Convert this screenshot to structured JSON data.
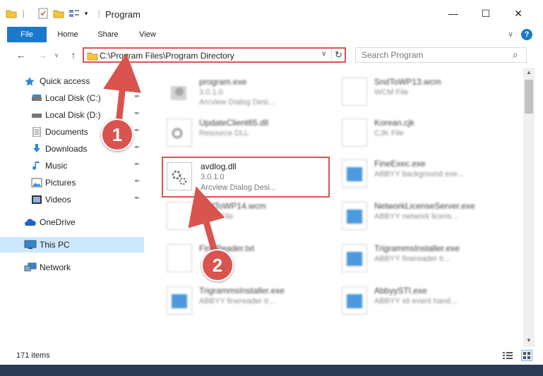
{
  "window": {
    "title": "Program",
    "min_glyph": "—",
    "max_glyph": "☐",
    "close_glyph": "✕"
  },
  "ribbon": {
    "tabs": [
      "File",
      "Home",
      "Share",
      "View"
    ],
    "collapse_glyph": "∨",
    "help_glyph": "?"
  },
  "nav": {
    "back_glyph": "←",
    "forward_glyph": "→",
    "recent_glyph": "∨",
    "up_glyph": "↑",
    "address": "C:\\Program Files\\Program Directory",
    "address_dropdown_glyph": "∨",
    "refresh_glyph": "↻",
    "search_placeholder": "Search Program",
    "search_glyph": "⌕"
  },
  "sidebar": {
    "items": [
      {
        "label": "Quick access",
        "icon": "star-icon"
      },
      {
        "label": "Local Disk (C:)",
        "icon": "drive-icon",
        "pinned": true
      },
      {
        "label": "Local Disk (D:)",
        "icon": "drive-icon",
        "pinned": true
      },
      {
        "label": "Documents",
        "icon": "documents-icon",
        "pinned": true
      },
      {
        "label": "Downloads",
        "icon": "download-icon",
        "pinned": true
      },
      {
        "label": "Music",
        "icon": "music-icon",
        "pinned": true
      },
      {
        "label": "Pictures",
        "icon": "pictures-icon",
        "pinned": true
      },
      {
        "label": "Videos",
        "icon": "videos-icon",
        "pinned": true
      },
      {
        "label": "OneDrive",
        "icon": "cloud-icon"
      },
      {
        "label": "This PC",
        "icon": "computer-icon",
        "selected": true
      },
      {
        "label": "Network",
        "icon": "network-icon"
      }
    ],
    "pin_glyph": "✒"
  },
  "files": [
    {
      "name": "program.exe",
      "line2": "3.0.1.0",
      "line3": "Arcview Dialog Desi...",
      "icon": "exe-icon"
    },
    {
      "name": "SndToWP13.wcm",
      "line2": "WCM File",
      "line3": "",
      "icon": "document-icon"
    },
    {
      "name": "UpdateClient65.dll",
      "line2": "Resource DLL",
      "line3": "",
      "icon": "gear-dll-icon"
    },
    {
      "name": "Korean.cjk",
      "line2": "CJK File",
      "line3": "",
      "icon": "document-icon"
    },
    {
      "name": "avdlog.dll",
      "line2": "3.0.1.0",
      "line3": "Arcview Dialog Desi...",
      "icon": "gear-dll-icon",
      "highlight": true
    },
    {
      "name": "FineExec.exe",
      "line2": "ABBYY background exe...",
      "line3": "",
      "icon": "app-icon"
    },
    {
      "name": "SndToWP14.wcm",
      "line2": "WCM File",
      "line3": "",
      "icon": "document-icon"
    },
    {
      "name": "NetworkLicenseServer.exe",
      "line2": "ABBYY network licens...",
      "line3": "",
      "icon": "app-icon"
    },
    {
      "name": "FineReader.txt",
      "line2": "",
      "line3": "",
      "icon": "document-icon"
    },
    {
      "name": "TrigrammsInstaller.exe",
      "line2": "ABBYY finereader tr...",
      "line3": "",
      "icon": "app-icon"
    },
    {
      "name": "TrigrammsInstaller.exe",
      "line2": "ABBYY finereader tr...",
      "line3": "",
      "icon": "app-icon"
    },
    {
      "name": "AbbyySTI.exe",
      "line2": "ABBYY sti event hand...",
      "line3": "",
      "icon": "app-icon"
    }
  ],
  "status": {
    "item_count": "171 items"
  },
  "annotations": {
    "step1": "1",
    "step2": "2",
    "color": "#d9534f"
  }
}
